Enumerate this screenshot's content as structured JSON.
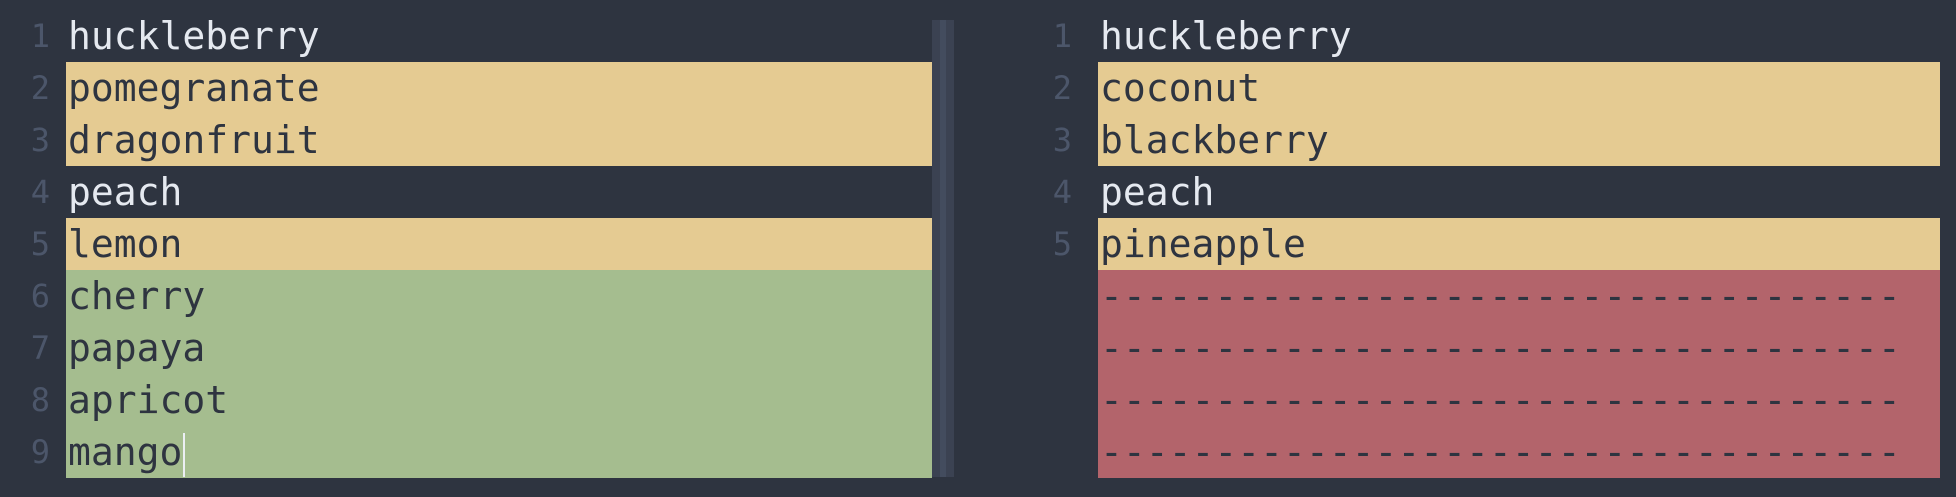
{
  "left": {
    "lines": [
      {
        "num": "1",
        "text": "huckleberry",
        "state": "normal"
      },
      {
        "num": "2",
        "text": "pomegranate",
        "state": "changed"
      },
      {
        "num": "3",
        "text": "dragonfruit",
        "state": "changed"
      },
      {
        "num": "4",
        "text": "peach",
        "state": "normal"
      },
      {
        "num": "5",
        "text": "lemon",
        "state": "changed"
      },
      {
        "num": "6",
        "text": "cherry",
        "state": "added"
      },
      {
        "num": "7",
        "text": "papaya",
        "state": "added"
      },
      {
        "num": "8",
        "text": "apricot",
        "state": "added"
      },
      {
        "num": "9",
        "text": "mango",
        "state": "added"
      }
    ]
  },
  "right": {
    "lines": [
      {
        "num": "1",
        "text": "huckleberry",
        "state": "normal"
      },
      {
        "num": "2",
        "text": "coconut",
        "state": "changed"
      },
      {
        "num": "3",
        "text": "blackberry",
        "state": "changed"
      },
      {
        "num": "4",
        "text": "peach",
        "state": "normal"
      },
      {
        "num": "5",
        "text": "pineapple",
        "state": "changed"
      },
      {
        "num": "",
        "text": "-----------------------------------",
        "state": "removed"
      },
      {
        "num": "",
        "text": "-----------------------------------",
        "state": "removed"
      },
      {
        "num": "",
        "text": "-----------------------------------",
        "state": "removed"
      },
      {
        "num": "",
        "text": "-----------------------------------",
        "state": "removed"
      }
    ]
  },
  "colors": {
    "background": "#2e3440",
    "changed": "#e5cb92",
    "added": "#a5bd8f",
    "removed": "#b3646b",
    "line_number": "#4c566a"
  }
}
